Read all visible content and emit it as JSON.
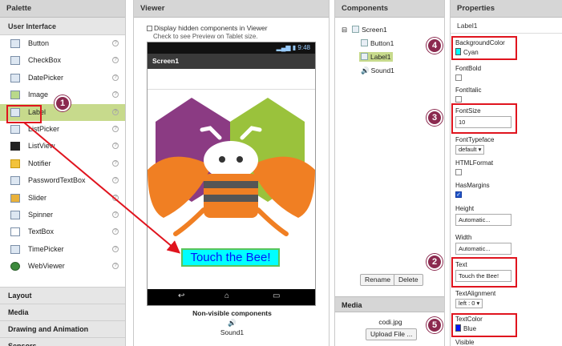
{
  "palette": {
    "header": "Palette",
    "category": "User Interface",
    "help_glyph": "?",
    "items": [
      {
        "label": "Button"
      },
      {
        "label": "CheckBox"
      },
      {
        "label": "DatePicker"
      },
      {
        "label": "Image"
      },
      {
        "label": "Label"
      },
      {
        "label": "ListPicker"
      },
      {
        "label": "ListView"
      },
      {
        "label": "Notifier"
      },
      {
        "label": "PasswordTextBox"
      },
      {
        "label": "Slider"
      },
      {
        "label": "Spinner"
      },
      {
        "label": "TextBox"
      },
      {
        "label": "TimePicker"
      },
      {
        "label": "WebViewer"
      }
    ],
    "bottom_categories": [
      "Layout",
      "Media",
      "Drawing and Animation",
      "Sensors"
    ]
  },
  "viewer": {
    "header": "Viewer",
    "hidden_checkbox_label": "Display hidden components in Viewer",
    "tablet_hint": "Check to see Preview on Tablet size.",
    "status_time": "9:48",
    "screen_title": "Screen1",
    "label_text": "Touch the Bee!",
    "non_visible_title": "Non-visible components",
    "non_visible_item": "Sound1"
  },
  "components": {
    "header": "Components",
    "tree": [
      "Screen1",
      "Button1",
      "Label1",
      "Sound1"
    ],
    "rename_label": "Rename",
    "delete_label": "Delete",
    "media_header": "Media",
    "media_file": "codi.jpg",
    "upload_label": "Upload File ..."
  },
  "properties": {
    "header": "Properties",
    "component_name": "Label1",
    "background_color_label": "BackgroundColor",
    "background_color_value": "Cyan",
    "font_bold_label": "FontBold",
    "font_italic_label": "FontItalic",
    "font_size_label": "FontSize",
    "font_size_value": "10",
    "font_typeface_label": "FontTypeface",
    "font_typeface_value": "default ▾",
    "html_format_label": "HTMLFormat",
    "has_margins_label": "HasMargins",
    "height_label": "Height",
    "height_value": "Automatic...",
    "width_label": "Width",
    "width_value": "Automatic...",
    "text_label": "Text",
    "text_value": "Touch the Bee!",
    "text_alignment_label": "TextAlignment",
    "text_alignment_value": "left : 0 ▾",
    "text_color_label": "TextColor",
    "text_color_value": "Blue",
    "visible_label": "Visible"
  },
  "badges": [
    "1",
    "2",
    "3",
    "4",
    "5"
  ],
  "colors": {
    "highlight_red": "#e0141e",
    "badge": "#8b2a4f",
    "selection_green": "#c7da8c",
    "cyan": "#00ffff",
    "blue": "#0013ff"
  }
}
